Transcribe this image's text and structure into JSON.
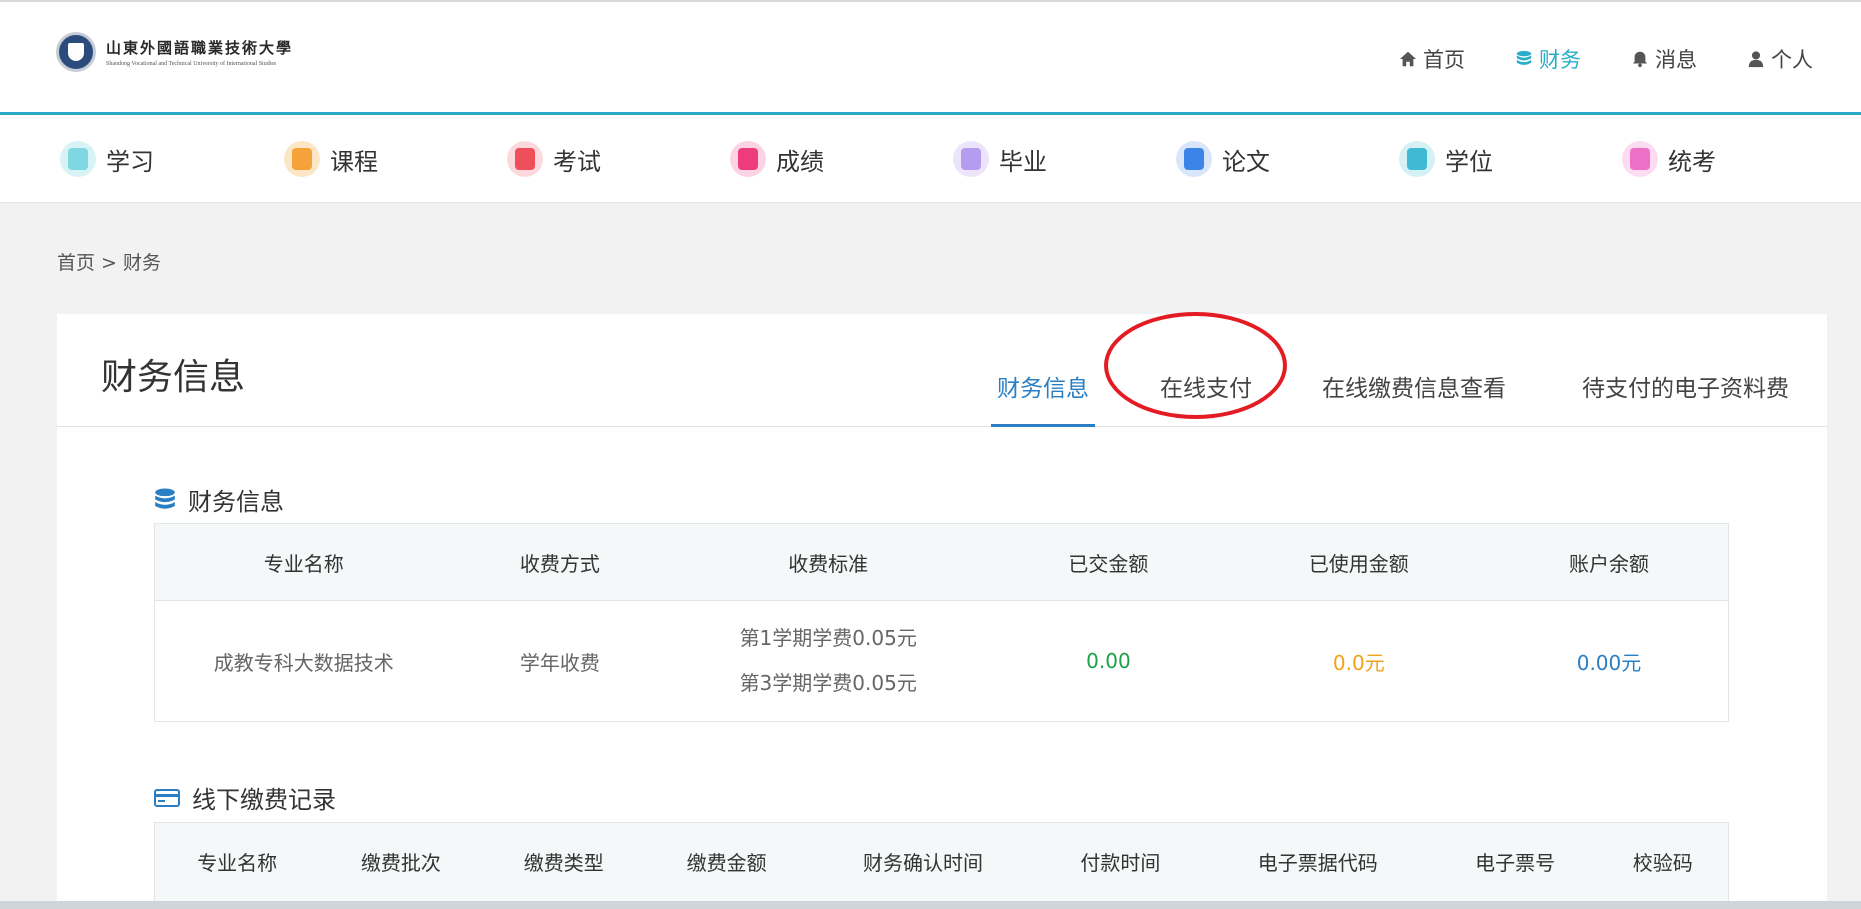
{
  "header": {
    "logo_cn": "山東外國語職業技術大學",
    "logo_en": "Shandong Vocational and Technical University of International Studies",
    "nav": [
      {
        "label": "首页",
        "icon": "home-icon"
      },
      {
        "label": "财务",
        "icon": "database-icon",
        "active": true
      },
      {
        "label": "消息",
        "icon": "bell-icon"
      },
      {
        "label": "个人",
        "icon": "user-icon"
      }
    ],
    "accent": "#2aaec8"
  },
  "categories": [
    {
      "label": "学习",
      "icon": "study-icon",
      "color": "#7fd7e2"
    },
    {
      "label": "课程",
      "icon": "course-icon",
      "color": "#f6a23a"
    },
    {
      "label": "考试",
      "icon": "exam-icon",
      "color": "#ef4f5a"
    },
    {
      "label": "成绩",
      "icon": "score-icon",
      "color": "#ee3b79"
    },
    {
      "label": "毕业",
      "icon": "graduation-icon",
      "color": "#b49df0"
    },
    {
      "label": "论文",
      "icon": "thesis-icon",
      "color": "#3d84e8"
    },
    {
      "label": "学位",
      "icon": "degree-icon",
      "color": "#3fb9d4"
    },
    {
      "label": "统考",
      "icon": "unified-exam-icon",
      "color": "#ee6fc6"
    }
  ],
  "breadcrumb": "首页 > 财务",
  "card": {
    "title": "财务信息",
    "tabs": [
      {
        "label": "财务信息",
        "active": true
      },
      {
        "label": "在线支付"
      },
      {
        "label": "在线缴费信息查看"
      },
      {
        "label": "待支付的电子资料费"
      }
    ]
  },
  "finance": {
    "section_title": "财务信息",
    "headers": [
      "专业名称",
      "收费方式",
      "收费标准",
      "已交金额",
      "已使用金额",
      "账户余额"
    ],
    "row": {
      "major": "成教专科大数据技术",
      "method": "学年收费",
      "standard": [
        "第1学期学费0.05元",
        "第3学期学费0.05元"
      ],
      "paid": "0.00",
      "used": "0.0元",
      "balance": "0.00元"
    },
    "colors": {
      "paid": "#1aa14a",
      "used": "#f2a21a",
      "balance": "#2a7fc4"
    }
  },
  "offline": {
    "section_title": "线下缴费记录",
    "headers": [
      "专业名称",
      "缴费批次",
      "缴费类型",
      "缴费金额",
      "财务确认时间",
      "付款时间",
      "电子票据代码",
      "电子票号",
      "校验码"
    ]
  }
}
